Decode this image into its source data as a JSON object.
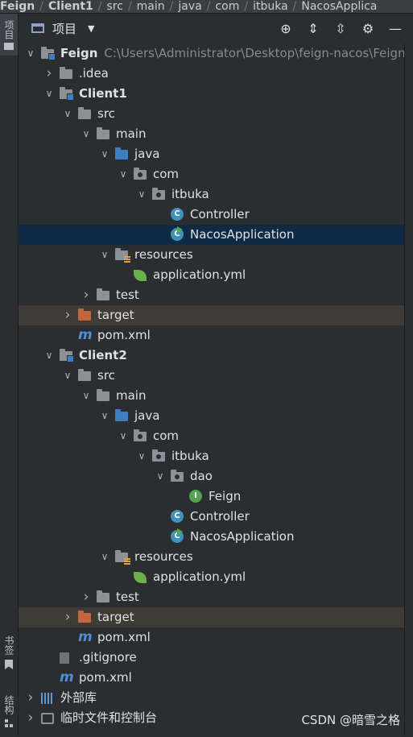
{
  "breadcrumb": [
    "Feign",
    "Client1",
    "src",
    "main",
    "java",
    "com",
    "itbuka",
    "NacosApplica"
  ],
  "left_strip": {
    "project_tab": "项目",
    "bookmarks_tab": "书签",
    "structure_tab": "结构"
  },
  "toolbar": {
    "title": "项目",
    "tools": [
      "locate-icon",
      "expand-icon",
      "collapse-icon",
      "gear-icon",
      "hide-icon"
    ]
  },
  "tree": [
    {
      "depth": 0,
      "arrow": "down",
      "icon": "module",
      "label": "Feign",
      "bold": true,
      "path": "C:\\Users\\Administrator\\Desktop\\feign-nacos\\Feign"
    },
    {
      "depth": 1,
      "arrow": "right",
      "icon": "folder-gray",
      "label": ".idea"
    },
    {
      "depth": 1,
      "arrow": "down",
      "icon": "module",
      "label": "Client1",
      "bold": true
    },
    {
      "depth": 2,
      "arrow": "down",
      "icon": "folder-gray",
      "label": "src"
    },
    {
      "depth": 3,
      "arrow": "down",
      "icon": "folder-gray",
      "label": "main"
    },
    {
      "depth": 4,
      "arrow": "down",
      "icon": "folder-blue",
      "label": "java"
    },
    {
      "depth": 5,
      "arrow": "down",
      "icon": "package",
      "label": "com"
    },
    {
      "depth": 6,
      "arrow": "down",
      "icon": "package",
      "label": "itbuka"
    },
    {
      "depth": 7,
      "arrow": "",
      "icon": "class",
      "label": "Controller"
    },
    {
      "depth": 7,
      "arrow": "",
      "icon": "class-app",
      "label": "NacosApplication",
      "selected": true
    },
    {
      "depth": 4,
      "arrow": "down",
      "icon": "resources",
      "label": "resources"
    },
    {
      "depth": 5,
      "arrow": "",
      "icon": "spring",
      "label": "application.yml"
    },
    {
      "depth": 3,
      "arrow": "right",
      "icon": "folder-gray",
      "label": "test"
    },
    {
      "depth": 2,
      "arrow": "right",
      "icon": "folder-orange",
      "label": "target",
      "excluded": true
    },
    {
      "depth": 2,
      "arrow": "",
      "icon": "maven",
      "label": "pom.xml"
    },
    {
      "depth": 1,
      "arrow": "down",
      "icon": "module",
      "label": "Client2",
      "bold": true
    },
    {
      "depth": 2,
      "arrow": "down",
      "icon": "folder-gray",
      "label": "src"
    },
    {
      "depth": 3,
      "arrow": "down",
      "icon": "folder-gray",
      "label": "main"
    },
    {
      "depth": 4,
      "arrow": "down",
      "icon": "folder-blue",
      "label": "java"
    },
    {
      "depth": 5,
      "arrow": "down",
      "icon": "package",
      "label": "com"
    },
    {
      "depth": 6,
      "arrow": "down",
      "icon": "package",
      "label": "itbuka"
    },
    {
      "depth": 7,
      "arrow": "down",
      "icon": "package",
      "label": "dao"
    },
    {
      "depth": 8,
      "arrow": "",
      "icon": "interface",
      "label": "Feign"
    },
    {
      "depth": 7,
      "arrow": "",
      "icon": "class",
      "label": "Controller"
    },
    {
      "depth": 7,
      "arrow": "",
      "icon": "class-app",
      "label": "NacosApplication"
    },
    {
      "depth": 4,
      "arrow": "down",
      "icon": "resources",
      "label": "resources"
    },
    {
      "depth": 5,
      "arrow": "",
      "icon": "spring",
      "label": "application.yml"
    },
    {
      "depth": 3,
      "arrow": "right",
      "icon": "folder-gray",
      "label": "test"
    },
    {
      "depth": 2,
      "arrow": "right",
      "icon": "folder-orange",
      "label": "target",
      "excluded": true
    },
    {
      "depth": 2,
      "arrow": "",
      "icon": "maven",
      "label": "pom.xml"
    },
    {
      "depth": 1,
      "arrow": "",
      "icon": "gitignore",
      "label": ".gitignore"
    },
    {
      "depth": 1,
      "arrow": "",
      "icon": "maven",
      "label": "pom.xml"
    },
    {
      "depth": 0,
      "arrow": "right",
      "icon": "libraries",
      "label": "外部库"
    },
    {
      "depth": 0,
      "arrow": "right",
      "icon": "scratches",
      "label": "临时文件和控制台"
    }
  ],
  "watermark": "CSDN @暗雪之格"
}
